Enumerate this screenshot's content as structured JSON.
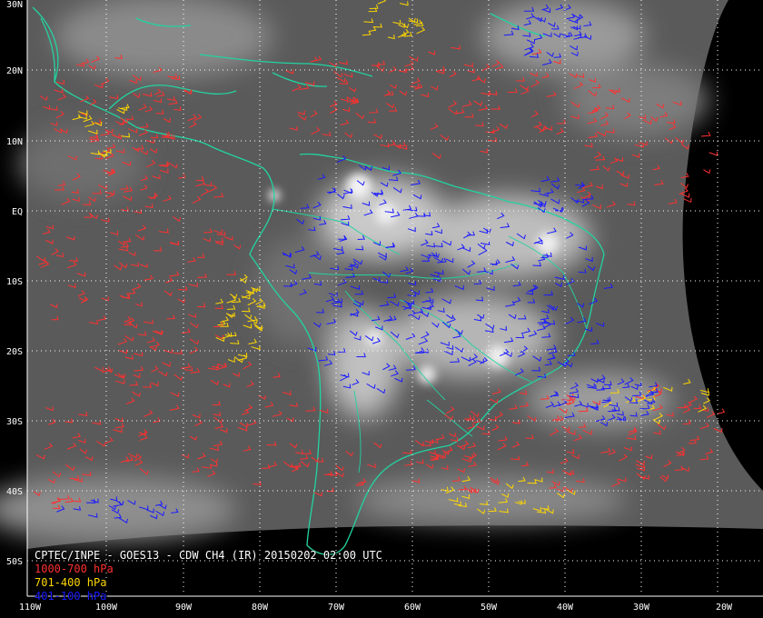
{
  "map": {
    "title": "CPTEC/INPE - GOES13 - CDW CH4 (IR) 20150202 02:00 UTC",
    "latitude_labels": [
      "30N",
      "20N",
      "10N",
      "EQ",
      "10S",
      "20S",
      "30S",
      "40S",
      "50S"
    ],
    "longitude_labels": [
      "110W",
      "100W",
      "90W",
      "80W",
      "70W",
      "60W",
      "50W",
      "40W",
      "30W",
      "20W"
    ],
    "legend": [
      {
        "label": "1000-700 hPa",
        "color": "#ff3030"
      },
      {
        "label": "701-400 hPa",
        "color": "#ffd700"
      },
      {
        "label": "401-100 hPa",
        "color": "#1a1aff"
      }
    ],
    "coastline_color": "#22d3a0",
    "grid_style": "white dotted",
    "background": "infrared satellite imagery (grayscale)"
  }
}
